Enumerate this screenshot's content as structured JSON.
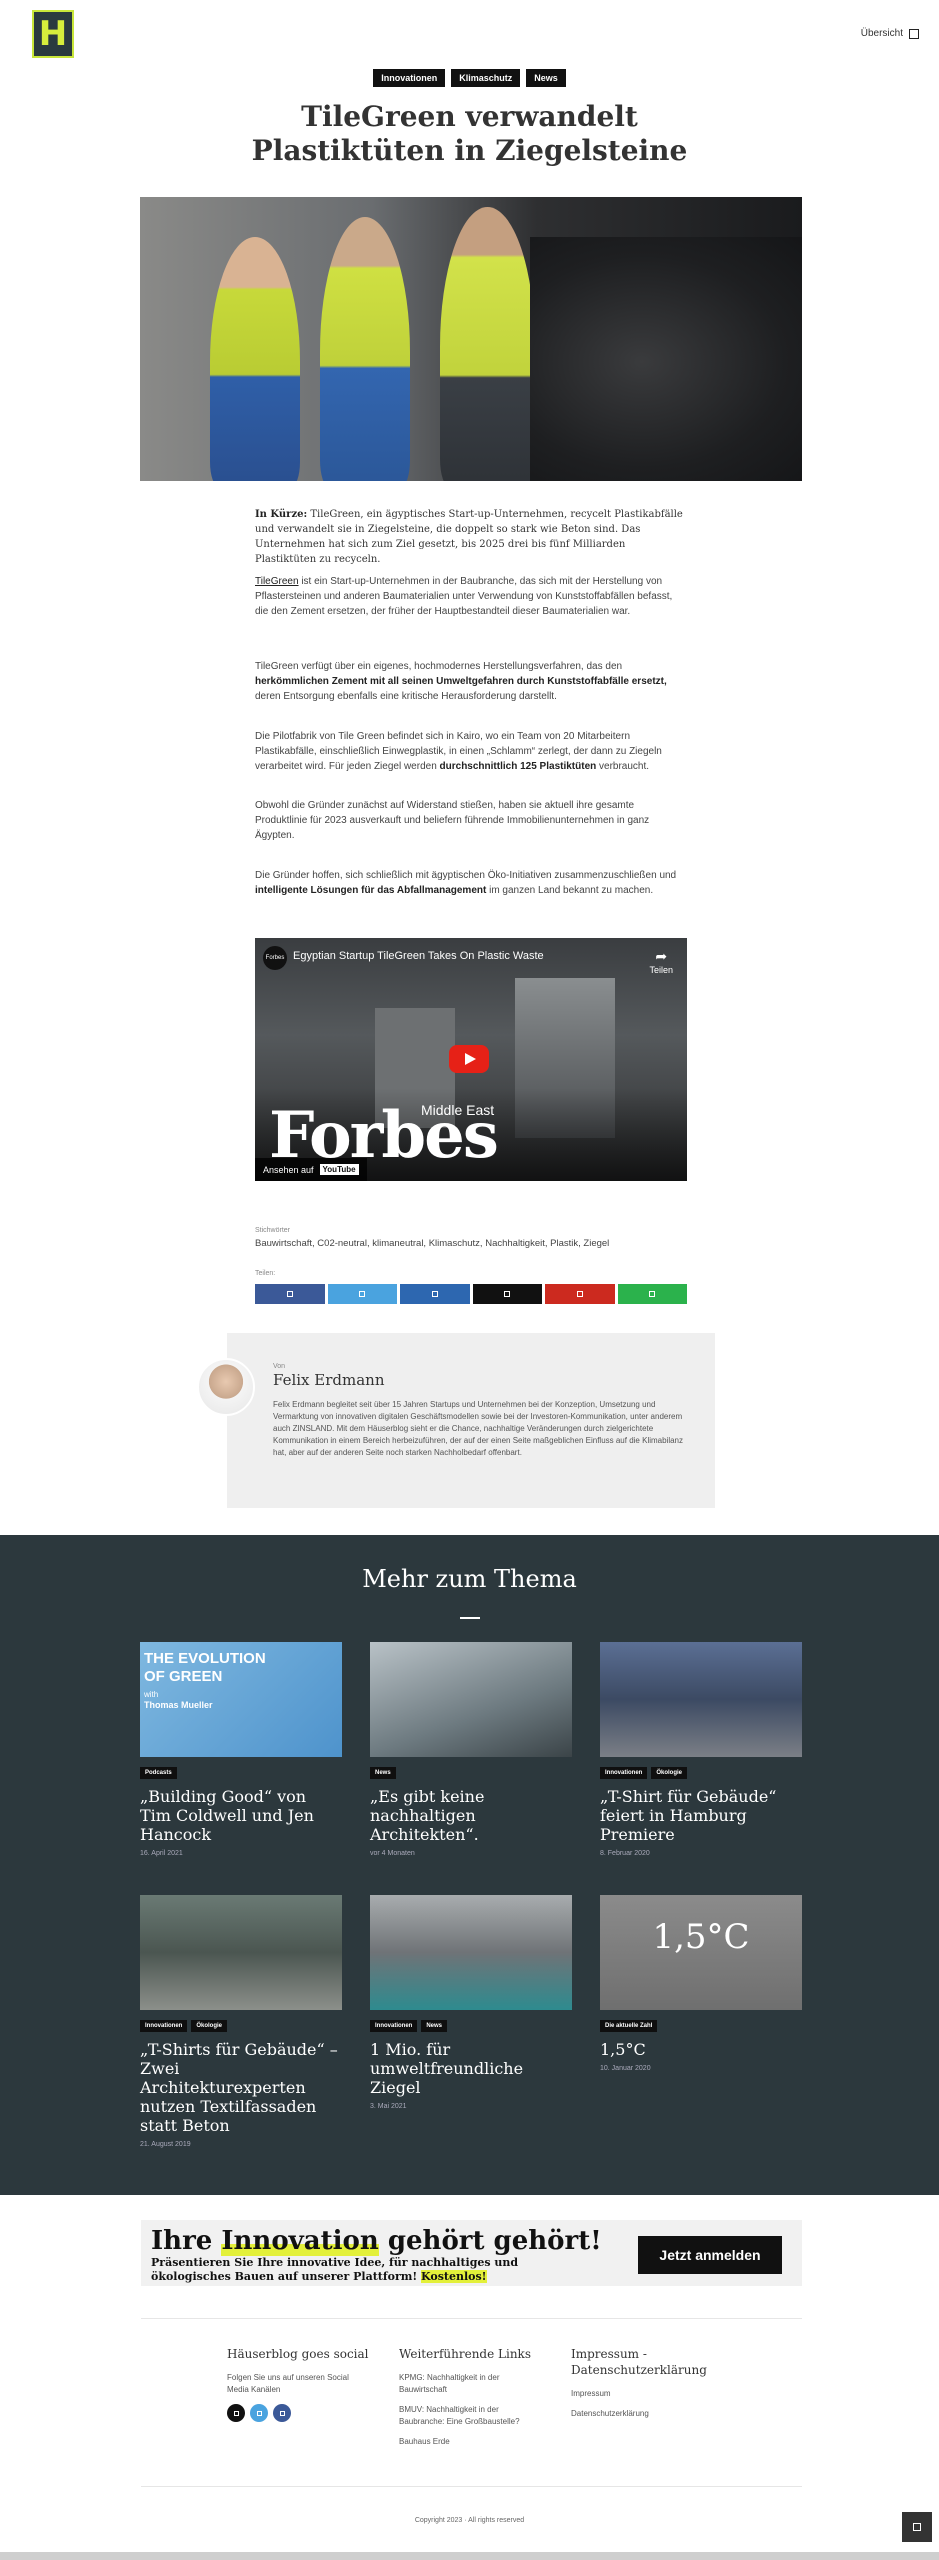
{
  "header": {
    "logo_letter": "H",
    "overview_label": "Übersicht"
  },
  "article": {
    "tags": [
      "Innovationen",
      "Klimaschutz",
      "News"
    ],
    "title_line1": "TileGreen verwandelt",
    "title_line2": "Plastiktüten in Ziegelsteine",
    "summary_label": "In Kürze:",
    "summary_text": "TileGreen, ein ägyptisches Start-up-Unternehmen, recycelt Plastikabfälle und verwandelt sie in Ziegelsteine, die doppelt so stark wie Beton sind. Das Unternehmen hat sich zum Ziel gesetzt, bis 2025 drei bis fünf Milliarden Plastiktüten zu recyceln.",
    "p1_link": "TileGreen",
    "p1_text": " ist ein Start-up-Unternehmen in der Baubranche, das sich mit der Herstellung von Pflastersteinen und anderen Baumaterialien unter Verwendung von Kunststoffabfällen befasst, die den Zement ersetzen, der früher der Hauptbestandteil dieser Baumaterialien war.",
    "p2_a": "TileGreen verfügt über ein eigenes, hochmodernes Herstellungsverfahren, das den ",
    "p2_bold": "herkömmlichen Zement mit all seinen Umweltgefahren durch Kunststoffabfälle ersetzt,",
    "p2_b": " deren Entsorgung ebenfalls eine kritische Herausforderung darstellt.",
    "p3_a": "Die Pilotfabrik von Tile Green befindet sich in Kairo, wo ein Team von 20 Mitarbeitern Plastikabfälle, einschließlich Einwegplastik, in einen „Schlamm“ zerlegt, der dann zu Ziegeln verarbeitet wird. Für jeden Ziegel werden ",
    "p3_bold": "durchschnittlich 125 Plastiktüten",
    "p3_b": " verbraucht.",
    "p4": "Obwohl die Gründer zunächst auf Widerstand stießen, haben sie aktuell ihre gesamte Produktlinie für 2023 ausverkauft und beliefern führende Immobilienunternehmen in ganz Ägypten.",
    "p5_a": "Die Gründer hoffen, sich schließlich mit ägyptischen Öko-Initiativen zusammenzuschließen und ",
    "p5_bold": "intelligente Lösungen für das Abfallmanagement",
    "p5_b": " im ganzen Land bekannt zu machen."
  },
  "video": {
    "channel": "Forbes",
    "title": "Egyptian Startup TileGreen Takes On Plastic Waste",
    "share_label": "Teilen",
    "brand": "Forbes",
    "brand_sub": "Middle East",
    "watch_on": "Ansehen auf",
    "youtube": "YouTube"
  },
  "keywords": {
    "label": "Stichwörter",
    "value": "Bauwirtschaft, C02-neutral, klimaneutral, Klimaschutz, Nachhaltigkeit, Plastik, Ziegel"
  },
  "share": {
    "label": "Teilen:",
    "colors": [
      "#3b5998",
      "#4aa3df",
      "#2d67b0",
      "#111111",
      "#cc2a1f",
      "#2bb24c"
    ]
  },
  "author": {
    "von": "Von",
    "name": "Felix Erdmann",
    "bio": "Felix Erdmann begleitet seit über 15 Jahren Startups und Unternehmen bei der Konzeption, Umsetzung und Vermarktung von innovativen digitalen Geschäftsmodellen sowie bei der Investoren-Kommunikation, unter anderem auch ZINSLAND. Mit dem Häuserblog sieht er die Chance, nachhaltige Veränderungen durch zielgerichtete Kommunikation in einem Bereich herbeizuführen, der auf der einen Seite maßgeblichen Einfluss auf die Klimabilanz hat, aber auf der anderen Seite noch starken Nachholbedarf offenbart."
  },
  "related": {
    "heading": "Mehr zum Thema",
    "cards": [
      {
        "tags": [
          "Podcasts"
        ],
        "title": "„Building Good“ von Tim Coldwell und Jen Hancock",
        "date": "16. April 2021",
        "img_text1": "THE EVOLUTION",
        "img_text2": "OF GREEN",
        "img_text3": "with",
        "img_text4": "Thomas Mueller"
      },
      {
        "tags": [
          "News"
        ],
        "title": "„Es gibt keine nachhaltigen Architekten“.",
        "date": "vor 4 Monaten"
      },
      {
        "tags": [
          "Innovationen",
          "Ökologie"
        ],
        "title": "„T-Shirt für Gebäude“ feiert in Hamburg Premiere",
        "date": "8. Februar 2020"
      },
      {
        "tags": [
          "Innovationen",
          "Ökologie"
        ],
        "title": "„T-Shirts für Gebäude“ – Zwei Architekturexperten nutzen Textilfassaden statt Beton",
        "date": "21. August 2019"
      },
      {
        "tags": [
          "Innovationen",
          "News"
        ],
        "title": "1 Mio. für umweltfreundliche Ziegel",
        "date": "3. Mai 2021"
      },
      {
        "tags": [
          "Die aktuelle Zahl"
        ],
        "title": "1,5°C",
        "date": "10. Januar 2020",
        "img_big": "1,5°C"
      }
    ]
  },
  "cta": {
    "title_a": "Ihre ",
    "title_hl": "Innovation",
    "title_b": " gehört gehört!",
    "sub_a": "Präsentieren Sie Ihre innovative Idee, für nachhaltiges und ökologisches Bauen auf unserer Plattform! ",
    "sub_hl": "Kostenlos!",
    "button": "Jetzt anmelden"
  },
  "footer": {
    "col1_title": "Häuserblog goes social",
    "col1_text": "Folgen Sie uns auf unseren Social Media Kanälen",
    "social_colors": [
      "#111111",
      "#4aa3df",
      "#3b5998"
    ],
    "col2_title": "Weiterführende Links",
    "col2_links": [
      "KPMG: Nachhaltigkeit in der Bauwirtschaft",
      "BMUV: Nachhaltigkeit in der Baubranche: Eine Großbaustelle?",
      "Bauhaus Erde"
    ],
    "col3_title": "Impressum - Datenschutzerklärung",
    "col3_links": [
      "Impressum",
      "Datenschutzerklärung"
    ],
    "copyright": "Copyright 2023 · All rights reserved"
  }
}
